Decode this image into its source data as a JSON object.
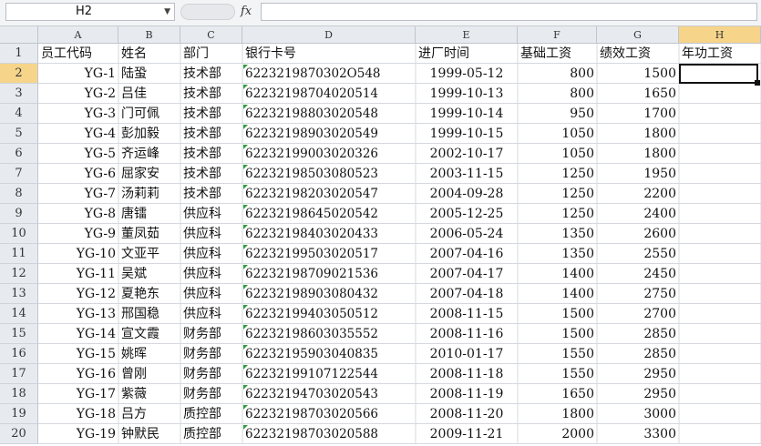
{
  "name_box": "H2",
  "fx_label": "fx",
  "formula_value": "",
  "columns": [
    "A",
    "B",
    "C",
    "D",
    "E",
    "F",
    "G",
    "H"
  ],
  "active_column": "H",
  "active_row": 2,
  "rows": [
    {
      "n": "1",
      "a": "员工代码",
      "b": "姓名",
      "c": "部门",
      "d": "银行卡号",
      "e": "进厂时间",
      "f": "基础工资",
      "g": "绩效工资",
      "h": "年功工资"
    },
    {
      "n": "2",
      "a": "YG-1",
      "b": "陆蛩",
      "c": "技术部",
      "d": "6223219870302O548",
      "e": "1999-05-12",
      "f": "800",
      "g": "1500",
      "h": ""
    },
    {
      "n": "3",
      "a": "YG-2",
      "b": "吕佳",
      "c": "技术部",
      "d": "62232198704020514",
      "e": "1999-10-13",
      "f": "800",
      "g": "1650",
      "h": ""
    },
    {
      "n": "4",
      "a": "YG-3",
      "b": "门可佩",
      "c": "技术部",
      "d": "62232198803020548",
      "e": "1999-10-14",
      "f": "950",
      "g": "1700",
      "h": ""
    },
    {
      "n": "5",
      "a": "YG-4",
      "b": "彭加毅",
      "c": "技术部",
      "d": "62232198903020549",
      "e": "1999-10-15",
      "f": "1050",
      "g": "1800",
      "h": ""
    },
    {
      "n": "6",
      "a": "YG-5",
      "b": "齐运峰",
      "c": "技术部",
      "d": "62232199003020326",
      "e": "2002-10-17",
      "f": "1050",
      "g": "1800",
      "h": ""
    },
    {
      "n": "7",
      "a": "YG-6",
      "b": "屈家安",
      "c": "技术部",
      "d": "62232198503080523",
      "e": "2003-11-15",
      "f": "1250",
      "g": "1950",
      "h": ""
    },
    {
      "n": "8",
      "a": "YG-7",
      "b": "汤莉莉",
      "c": "技术部",
      "d": "62232198203020547",
      "e": "2004-09-28",
      "f": "1250",
      "g": "2200",
      "h": ""
    },
    {
      "n": "9",
      "a": "YG-8",
      "b": "唐镭",
      "c": "供应科",
      "d": "62232198645020542",
      "e": "2005-12-25",
      "f": "1250",
      "g": "2400",
      "h": ""
    },
    {
      "n": "10",
      "a": "YG-9",
      "b": "董凤茹",
      "c": "供应科",
      "d": "62232198403020433",
      "e": "2006-05-24",
      "f": "1350",
      "g": "2600",
      "h": ""
    },
    {
      "n": "11",
      "a": "YG-10",
      "b": "文亚平",
      "c": "供应科",
      "d": "62232199503020517",
      "e": "2007-04-16",
      "f": "1350",
      "g": "2550",
      "h": ""
    },
    {
      "n": "12",
      "a": "YG-11",
      "b": "吴斌",
      "c": "供应科",
      "d": "62232198709021536",
      "e": "2007-04-17",
      "f": "1400",
      "g": "2450",
      "h": ""
    },
    {
      "n": "13",
      "a": "YG-12",
      "b": "夏艳东",
      "c": "供应科",
      "d": "62232198903080432",
      "e": "2007-04-18",
      "f": "1400",
      "g": "2750",
      "h": ""
    },
    {
      "n": "14",
      "a": "YG-13",
      "b": "邢国稳",
      "c": "供应科",
      "d": "62232199403050512",
      "e": "2008-11-15",
      "f": "1500",
      "g": "2700",
      "h": ""
    },
    {
      "n": "15",
      "a": "YG-14",
      "b": "宣文霞",
      "c": "财务部",
      "d": "62232198603035552",
      "e": "2008-11-16",
      "f": "1500",
      "g": "2850",
      "h": ""
    },
    {
      "n": "16",
      "a": "YG-15",
      "b": "姚晖",
      "c": "财务部",
      "d": "62232195903040835",
      "e": "2010-01-17",
      "f": "1550",
      "g": "2850",
      "h": ""
    },
    {
      "n": "17",
      "a": "YG-16",
      "b": "曾刚",
      "c": "财务部",
      "d": "62232199107122544",
      "e": "2008-11-18",
      "f": "1550",
      "g": "2950",
      "h": ""
    },
    {
      "n": "18",
      "a": "YG-17",
      "b": "紫薇",
      "c": "财务部",
      "d": "62232194703020543",
      "e": "2008-11-19",
      "f": "1650",
      "g": "2950",
      "h": ""
    },
    {
      "n": "19",
      "a": "YG-18",
      "b": "吕方",
      "c": "质控部",
      "d": "62232198703020566",
      "e": "2008-11-20",
      "f": "1800",
      "g": "3000",
      "h": ""
    },
    {
      "n": "20",
      "a": "YG-19",
      "b": "钟默民",
      "c": "质控部",
      "d": "62232198703020588",
      "e": "2009-11-21",
      "f": "2000",
      "g": "3300",
      "h": ""
    }
  ]
}
